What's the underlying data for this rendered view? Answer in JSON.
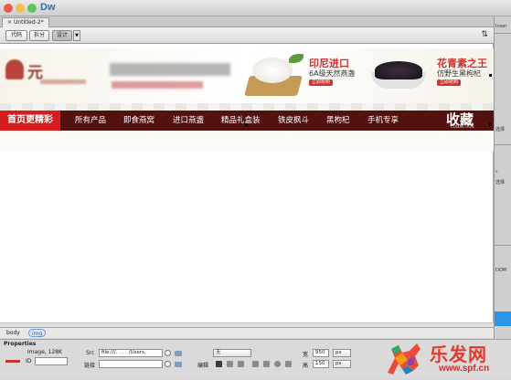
{
  "app": {
    "name": "Dw"
  },
  "window": {
    "traffic": [
      "#ed594e",
      "#f5bf4f",
      "#60c454"
    ]
  },
  "document_tab": {
    "label": "Untitled-2*",
    "close": "×"
  },
  "toolbar": {
    "views": [
      "代码",
      "拆分",
      "设计"
    ],
    "active_view": "设计",
    "dropdown": "▼",
    "refresh_icon": "⇅"
  },
  "banner": {
    "promo1": {
      "title": "印尼进口",
      "subtitle": "6A级天然燕盏",
      "tag": "立即抢购"
    },
    "promo2": {
      "title": "花青素之王",
      "subtitle": "仿野生黑枸杞",
      "tag": "立即抢购"
    }
  },
  "navbar": {
    "home": "首页更精彩",
    "items": [
      "所有产品",
      "即食燕窝",
      "进口燕盏",
      "精品礼盒装",
      "铁皮枫斗",
      "黑枸杞",
      "手机专享"
    ],
    "favorite": "收藏",
    "favorite_sub": "COLLECTION",
    "colors": {
      "bar": "#53110f",
      "home": "#d71c1c"
    }
  },
  "statusbar": {
    "tags": [
      "body",
      "img"
    ]
  },
  "properties": {
    "title": "Properties",
    "image_label": "Image, 128K",
    "id_label": "ID",
    "src_label": "Src",
    "src_value": "file:///. . . . /Users,",
    "link_label": "链接",
    "edit_label": "编辑",
    "class_value": "无",
    "width_label": "宽",
    "width_value": "950",
    "height_label": "高",
    "height_value": "150",
    "unit": "px"
  },
  "right_panel": {
    "labels": [
      "Inser",
      "选择",
      "选择",
      "DOM"
    ]
  },
  "watermark": {
    "text": "乐发网",
    "url": "www.spf.cn"
  }
}
